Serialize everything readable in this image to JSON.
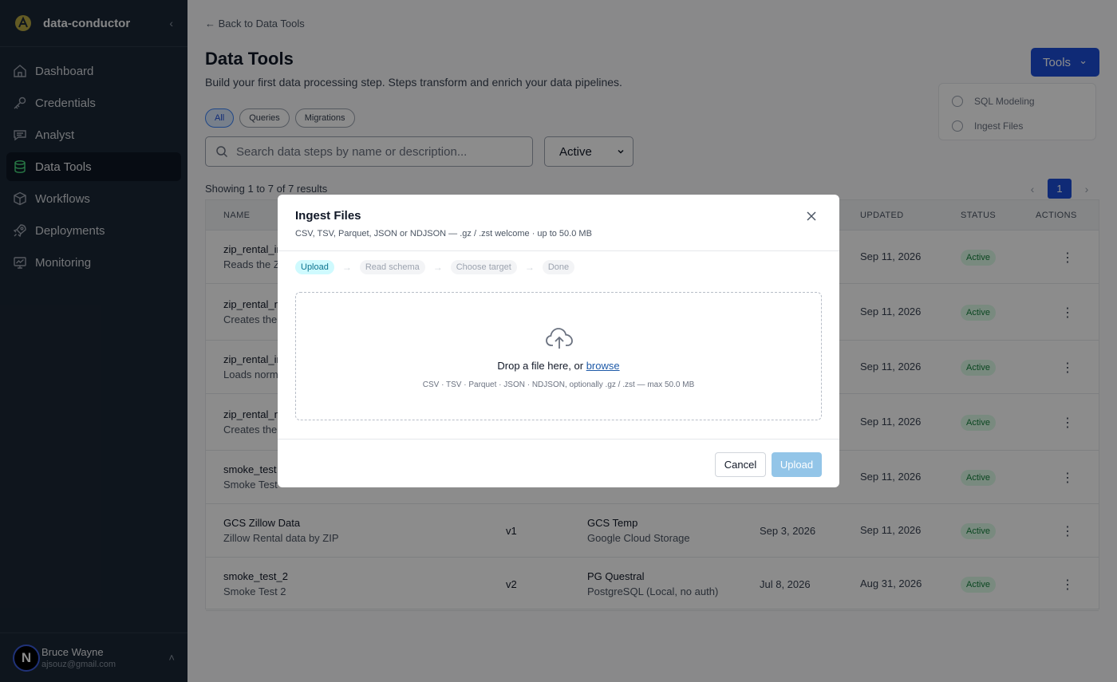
{
  "app": {
    "name": "data-conductor",
    "collapse_glyph": "‹",
    "logo_color": "#b5a642",
    "accent": "#1d4ed8"
  },
  "sidebar": {
    "items": [
      {
        "label": "Dashboard",
        "icon": "home-icon"
      },
      {
        "label": "Credentials",
        "icon": "key-icon"
      },
      {
        "label": "Analyst",
        "icon": "chat-icon"
      },
      {
        "label": "Data Tools",
        "icon": "database-icon",
        "active": true
      },
      {
        "label": "Workflows",
        "icon": "cube-icon"
      },
      {
        "label": "Deployments",
        "icon": "rocket-icon"
      },
      {
        "label": "Monitoring",
        "icon": "monitor-icon"
      }
    ]
  },
  "user": {
    "initial": "N",
    "name": "Bruce Wayne",
    "email": "ajsouz@gmail.com",
    "chevron": "˄"
  },
  "page": {
    "back_label": "← Back to Data Tools",
    "title": "Data Tools",
    "subtitle": "Build your first data processing step. Steps transform and enrich your data pipelines.",
    "tools_button": "Tools",
    "tools_chevron": "⌄",
    "tools_menu": [
      "SQL Modeling",
      "Ingest Files"
    ],
    "chips": [
      "All",
      "Queries",
      "Migrations"
    ],
    "search_placeholder": "Search data steps by name or description...",
    "status_filter": "Active",
    "showing": "Showing 1 to 7 of 7 results",
    "pager": {
      "prev": "‹",
      "current": "1",
      "next": "›"
    }
  },
  "table": {
    "headers": {
      "name": "NAME",
      "updated": "UPDATED",
      "status": "STATUS",
      "actions": "ACTIONS"
    },
    "rows": [
      {
        "name": "zip_rental_in",
        "desc": "Reads the Z",
        "version": "",
        "source": "",
        "source_desc": "",
        "created": "",
        "updated": "Sep 11, 2026",
        "status": "Active"
      },
      {
        "name": "zip_rental_n",
        "desc": "Creates the",
        "version": "",
        "source": "",
        "source_desc": "",
        "created": "",
        "updated": "Sep 11, 2026",
        "status": "Active"
      },
      {
        "name": "zip_rental_in",
        "desc": "Loads norm",
        "version": "",
        "source": "",
        "source_desc": "",
        "created": "",
        "updated": "Sep 11, 2026",
        "status": "Active"
      },
      {
        "name": "zip_rental_n",
        "desc": "Creates the",
        "version": "",
        "source": "",
        "source_desc": "",
        "created": "",
        "updated": "Sep 11, 2026",
        "status": "Active"
      },
      {
        "name": "smoke_test",
        "desc": "Smoke Test",
        "version": "",
        "source": "",
        "source_desc": "",
        "created": "",
        "updated": "Sep 11, 2026",
        "status": "Active"
      },
      {
        "name": "GCS Zillow Data",
        "desc": "Zillow Rental data by ZIP",
        "version": "v1",
        "source": "GCS Temp",
        "source_desc": "Google Cloud Storage",
        "created": "Sep 3, 2026",
        "updated": "Sep 11, 2026",
        "status": "Active"
      },
      {
        "name": "smoke_test_2",
        "desc": "Smoke Test 2",
        "version": "v2",
        "source": "PG Questral",
        "source_desc": "PostgreSQL (Local, no auth)",
        "created": "Jul 8, 2026",
        "updated": "Aug 31, 2026",
        "status": "Active"
      }
    ],
    "kebab": "⋮"
  },
  "modal": {
    "title": "Ingest Files",
    "subtitle": "CSV, TSV, Parquet, JSON or NDJSON — .gz / .zst welcome · up to 50.0 MB",
    "steps": [
      "Upload",
      "Read schema",
      "Choose target",
      "Done"
    ],
    "step_arrow": "→",
    "drop_text": "Drop a file here, or",
    "browse": "browse",
    "hint": "CSV · TSV · Parquet · JSON · NDJSON, optionally .gz / .zst — max 50.0 MB",
    "cancel": "Cancel",
    "upload": "Upload"
  }
}
